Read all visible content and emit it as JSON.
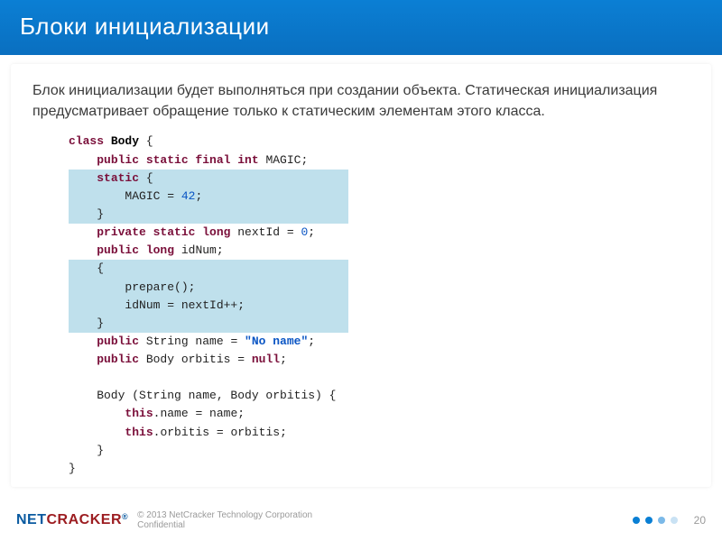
{
  "header": {
    "title": "Блоки инициализации"
  },
  "description": "Блок инициализации будет выполняться при создании объекта. Статическая инициализация предусматривает обращение только к статическим элементам этого класса.",
  "code": {
    "lines": [
      {
        "hl": false,
        "tokens": [
          {
            "t": "kw",
            "v": "class "
          },
          {
            "t": "cls",
            "v": "Body"
          },
          {
            "t": "p",
            "v": " {"
          }
        ]
      },
      {
        "hl": false,
        "tokens": [
          {
            "t": "p",
            "v": "    "
          },
          {
            "t": "kw",
            "v": "public static final int "
          },
          {
            "t": "p",
            "v": "MAGIC;"
          }
        ]
      },
      {
        "hl": true,
        "tokens": [
          {
            "t": "p",
            "v": "    "
          },
          {
            "t": "kw",
            "v": "static"
          },
          {
            "t": "p",
            "v": " {"
          }
        ]
      },
      {
        "hl": true,
        "tokens": [
          {
            "t": "p",
            "v": "        MAGIC = "
          },
          {
            "t": "num",
            "v": "42"
          },
          {
            "t": "p",
            "v": ";"
          }
        ]
      },
      {
        "hl": true,
        "tokens": [
          {
            "t": "p",
            "v": "    }"
          }
        ]
      },
      {
        "hl": false,
        "tokens": [
          {
            "t": "p",
            "v": "    "
          },
          {
            "t": "kw",
            "v": "private static long "
          },
          {
            "t": "p",
            "v": "nextId = "
          },
          {
            "t": "num",
            "v": "0"
          },
          {
            "t": "p",
            "v": ";"
          }
        ]
      },
      {
        "hl": false,
        "tokens": [
          {
            "t": "p",
            "v": "    "
          },
          {
            "t": "kw",
            "v": "public long "
          },
          {
            "t": "p",
            "v": "idNum;"
          }
        ]
      },
      {
        "hl": true,
        "tokens": [
          {
            "t": "p",
            "v": "    {"
          }
        ]
      },
      {
        "hl": true,
        "tokens": [
          {
            "t": "p",
            "v": "        prepare();"
          }
        ]
      },
      {
        "hl": true,
        "tokens": [
          {
            "t": "p",
            "v": "        idNum = nextId++;"
          }
        ]
      },
      {
        "hl": true,
        "tokens": [
          {
            "t": "p",
            "v": "    }"
          }
        ]
      },
      {
        "hl": false,
        "tokens": [
          {
            "t": "p",
            "v": "    "
          },
          {
            "t": "kw",
            "v": "public "
          },
          {
            "t": "p",
            "v": "String name = "
          },
          {
            "t": "str",
            "v": "\"No name\""
          },
          {
            "t": "p",
            "v": ";"
          }
        ]
      },
      {
        "hl": false,
        "tokens": [
          {
            "t": "p",
            "v": "    "
          },
          {
            "t": "kw",
            "v": "public "
          },
          {
            "t": "p",
            "v": "Body orbitis = "
          },
          {
            "t": "kw",
            "v": "null"
          },
          {
            "t": "p",
            "v": ";"
          }
        ]
      },
      {
        "hl": false,
        "tokens": []
      },
      {
        "hl": false,
        "tokens": [
          {
            "t": "p",
            "v": "    Body (String name, Body orbitis) {"
          }
        ]
      },
      {
        "hl": false,
        "tokens": [
          {
            "t": "p",
            "v": "        "
          },
          {
            "t": "kw",
            "v": "this"
          },
          {
            "t": "p",
            "v": ".name = name;"
          }
        ]
      },
      {
        "hl": false,
        "tokens": [
          {
            "t": "p",
            "v": "        "
          },
          {
            "t": "kw",
            "v": "this"
          },
          {
            "t": "p",
            "v": ".orbitis = orbitis;"
          }
        ]
      },
      {
        "hl": false,
        "tokens": [
          {
            "t": "p",
            "v": "    }"
          }
        ]
      },
      {
        "hl": false,
        "tokens": [
          {
            "t": "p",
            "v": "}"
          }
        ]
      }
    ]
  },
  "footer": {
    "logo_part1": "NET",
    "logo_part2": "CRACKER",
    "reg": "®",
    "copyright_line1": "© 2013 NetCracker Technology Corporation",
    "copyright_line2": "Confidential",
    "page_number": "20"
  }
}
